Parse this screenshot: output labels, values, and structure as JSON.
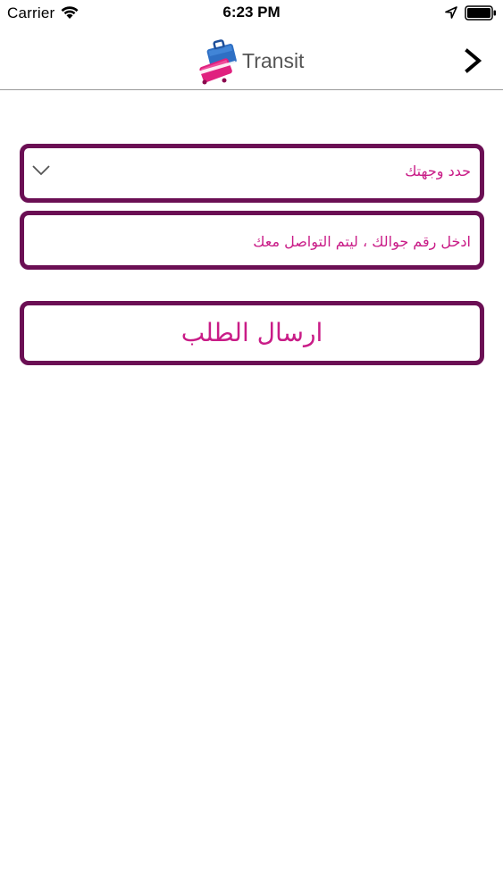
{
  "status_bar": {
    "carrier": "Carrier",
    "time": "6:23 PM"
  },
  "nav": {
    "brand": "Transit",
    "icons": {
      "logo": "suitcase-plane-logo-icon",
      "forward": "chevron-right-icon"
    }
  },
  "form": {
    "destination_label": "حدد وجهتك",
    "phone_label": "ادخل رقم جوالك ، ليتم التواصل معك",
    "submit_label": "ارسال الطلب"
  },
  "colors": {
    "border": "#6b0f54",
    "text_accent": "#c91c87",
    "background": "#ffffff"
  }
}
